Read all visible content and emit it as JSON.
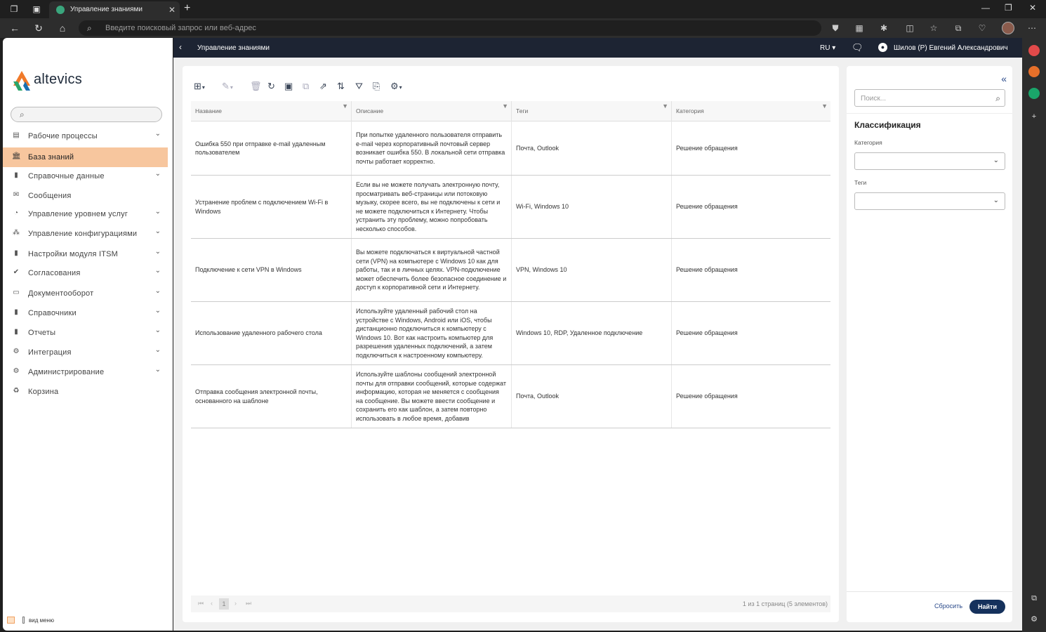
{
  "browser": {
    "tab_title": "Управление знаниями",
    "address_placeholder": "Введите поисковый запрос или веб-адрес"
  },
  "sidebar": {
    "logo_text": "altevics",
    "menu": [
      {
        "label": "Рабочие процессы",
        "icon": "processes-icon",
        "has_children": true
      },
      {
        "label": "База знаний",
        "icon": "bank-icon",
        "has_children": false,
        "active": true
      },
      {
        "label": "Справочные данные",
        "icon": "book-icon",
        "has_children": true
      },
      {
        "label": "Сообщения",
        "icon": "envelope-icon",
        "has_children": false
      },
      {
        "label": "Управление уровнем услуг",
        "icon": "pie-chart-icon",
        "has_children": true
      },
      {
        "label": "Управление конфигурациями",
        "icon": "hierarchy-icon",
        "has_children": true
      },
      {
        "label": "Настройки модуля ITSM",
        "icon": "book-icon",
        "has_children": true
      },
      {
        "label": "Согласования",
        "icon": "check-icon",
        "has_children": true
      },
      {
        "label": "Документооборот",
        "icon": "inbox-icon",
        "has_children": true
      },
      {
        "label": "Справочники",
        "icon": "book-icon",
        "has_children": true
      },
      {
        "label": "Отчеты",
        "icon": "book-icon",
        "has_children": true
      },
      {
        "label": "Интеграция",
        "icon": "gear-icon",
        "has_children": true
      },
      {
        "label": "Администрирование",
        "icon": "gear-icon",
        "has_children": true
      },
      {
        "label": "Корзина",
        "icon": "recycle-icon",
        "has_children": false
      }
    ],
    "footer_label": "вид меню"
  },
  "header": {
    "title": "Управление знаниями",
    "lang": "RU ▾",
    "user": "Шилов (Р) Евгений Александрович"
  },
  "grid": {
    "columns": [
      "Название",
      "Описание",
      "Теги",
      "Категория"
    ],
    "rows": [
      {
        "name": "Ошибка 550 при отправке e-mail удаленным пользователем",
        "desc": "При попытке удаленного пользователя отправить e-mail через корпоративный почтовый сервер возникает ошибка 550. В локальной сети отправка почты работает корректно.",
        "tags": "Почта, Outlook",
        "category": "Решение обращения"
      },
      {
        "name": "Устранение проблем с подключением Wi-Fi в Windows",
        "desc": "Если вы не можете получать электронную почту, просматривать веб-страницы или потоковую музыку, скорее всего, вы не подключены к сети и не можете подключиться к Интернету. Чтобы устранить эту проблему, можно попробовать несколько способов.",
        "tags": "Wi-Fi, Windows 10",
        "category": "Решение обращения"
      },
      {
        "name": "Подключение к сети VPN в Windows",
        "desc": "Вы можете подключаться к виртуальной частной сети (VPN) на компьютере с Windows 10 как для работы, так и в личных целях. VPN-подключение может обеспечить более безопасное соединение и доступ к корпоративной сети и Интернету.",
        "tags": "VPN, Windows 10",
        "category": "Решение обращения"
      },
      {
        "name": "Использование удаленного рабочего стола",
        "desc": "Используйте удаленный рабочий стол на устройстве с Windows, Android или iOS, чтобы дистанционно подключиться к компьютеру с Windows 10. Вот как настроить компьютер для разрешения удаленных подключений, а затем подключиться к настроенному компьютеру.",
        "tags": "Windows 10, RDP, Удаленное подключение",
        "category": "Решение обращения"
      },
      {
        "name": "Отправка сообщения электронной почты, основанного на шаблоне",
        "desc": "Используйте шаблоны сообщений электронной почты для отправки сообщений, которые содержат информацию, которая не меняется с сообщения на сообщение. Вы можете ввести сообщение и сохранить его как шаблон, а затем повторно использовать в любое время, добавив",
        "tags": "Почта, Outlook",
        "category": "Решение обращения"
      }
    ]
  },
  "pager": {
    "page": "1",
    "info": "1 из 1 страниц (5 элементов)"
  },
  "filter_panel": {
    "search_placeholder": "Поиск...",
    "section_title": "Классификация",
    "category_label": "Категория",
    "tags_label": "Теги",
    "reset_label": "Сбросить",
    "find_label": "Найти"
  }
}
